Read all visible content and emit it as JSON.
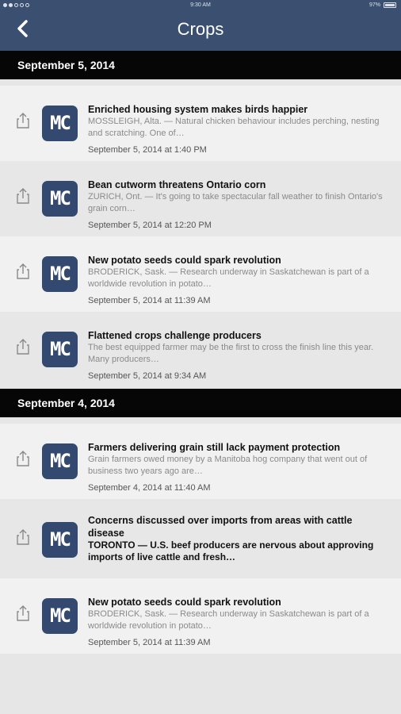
{
  "status_bar": {
    "time": "9:30 AM",
    "battery": "97%"
  },
  "nav": {
    "title": "Crops"
  },
  "sections": [
    {
      "label": "September 5, 2014"
    },
    {
      "label": "September 4, 2014"
    }
  ],
  "articles": [
    {
      "title": "Enriched housing system makes birds happier",
      "summary": "MOSSLEIGH, Alta. — Natural chicken behaviour includes perching, nesting and scratching. One of…",
      "date": "September 5, 2014 at 1:40 PM",
      "logo": "MC"
    },
    {
      "title": "Bean cutworm threatens Ontario corn",
      "summary": "ZURICH, Ont. — It's going to take spectacular fall weather to finish Ontario's grain corn…",
      "date": "September 5, 2014 at 12:20 PM",
      "logo": "MC"
    },
    {
      "title": "New potato seeds could spark revolution",
      "summary": "BRODERICK, Sask. — Research underway in Saskatchewan is part of a worldwide revolution in potato…",
      "date": "September 5, 2014 at 11:39 AM",
      "logo": "MC"
    },
    {
      "title": "Flattened crops challenge producers",
      "summary": "The best equipped farmer may be the first to cross the finish line this year. Many producers…",
      "date": "September 5, 2014 at 9:34 AM",
      "logo": "MC"
    },
    {
      "title": "Farmers delivering grain still lack payment protection",
      "summary": "Grain farmers owed money by a Manitoba hog company that went out of business two years ago are…",
      "date": "September 4, 2014 at 11:40 AM",
      "logo": "MC"
    },
    {
      "title": "Concerns discussed over imports from areas with cattle disease",
      "summary": "TORONTO — U.S. beef producers are nervous about approving imports of live cattle and fresh…",
      "date": "",
      "logo": "MC"
    },
    {
      "title": "New potato seeds could spark revolution",
      "summary": "BRODERICK, Sask. — Research underway in Saskatchewan is part of a worldwide revolution in potato…",
      "date": "September 5, 2014 at 11:39 AM",
      "logo": "MC"
    }
  ]
}
